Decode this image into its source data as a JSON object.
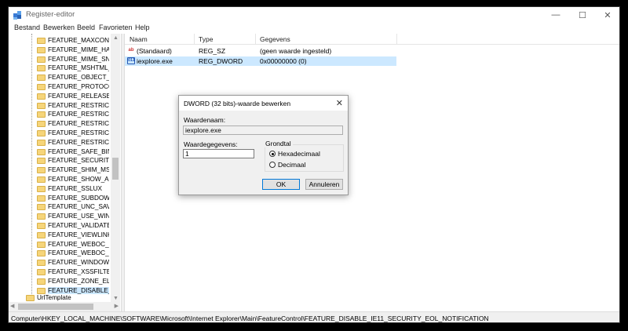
{
  "window": {
    "title": "Register-editor",
    "controls": {
      "minimize": "—",
      "maximize": "☐",
      "close": "✕"
    }
  },
  "menu": [
    "Bestand",
    "Bewerken",
    "Beeld",
    "Favorieten",
    "Help"
  ],
  "tree": {
    "items": [
      "FEATURE_MAXCONNEC",
      "FEATURE_MIME_HANDI",
      "FEATURE_MIME_SNIFFII",
      "FEATURE_MSHTML_AU",
      "FEATURE_OBJECT_CACI",
      "FEATURE_PROTOCOL_L",
      "FEATURE_RELEASE_CAL",
      "FEATURE_RESTRICT_AB",
      "FEATURE_RESTRICT_AC",
      "FEATURE_RESTRICT_FIL",
      "FEATURE_RESTRICT_OB",
      "FEATURE_RESTRICT_RES",
      "FEATURE_SAFE_BINDTO",
      "FEATURE_SECURITYBAN",
      "FEATURE_SHIM_MSHEL",
      "FEATURE_SHOW_APP_P",
      "FEATURE_SSLUX",
      "FEATURE_SUBDOWNLO",
      "FEATURE_UNC_SAVEDFI",
      "FEATURE_USE_WINDOW",
      "FEATURE_VALIDATE_NA",
      "FEATURE_VIEWLINKEDV",
      "FEATURE_WEBOC_MOV",
      "FEATURE_WEBOC_POPI",
      "FEATURE_WINDOW_RES",
      "FEATURE_XSSFILTER",
      "FEATURE_ZONE_ELEVAT",
      "FEATURE_DISABLE_IE11"
    ],
    "selected_index": 27,
    "sibling": "UrlTemplate"
  },
  "list": {
    "columns": [
      "Naam",
      "Type",
      "Gegevens"
    ],
    "rows": [
      {
        "icon": "ab",
        "name": "(Standaard)",
        "type": "REG_SZ",
        "data": "(geen waarde ingesteld)"
      },
      {
        "icon": "bin",
        "name": "iexplore.exe",
        "type": "REG_DWORD",
        "data": "0x00000000 (0)"
      }
    ],
    "selected_index": 1
  },
  "status": "Computer\\HKEY_LOCAL_MACHINE\\SOFTWARE\\Microsoft\\Internet Explorer\\Main\\FeatureControl\\FEATURE_DISABLE_IE11_SECURITY_EOL_NOTIFICATION",
  "dialog": {
    "title": "DWORD (32 bits)-waarde bewerken",
    "close": "✕",
    "value_name_label": "Waardenaam:",
    "value_name": "iexplore.exe",
    "value_data_label": "Waardegegevens:",
    "value_data": "1",
    "base_label": "Grondtal",
    "radio_hex": "Hexadecimaal",
    "radio_dec": "Decimaal",
    "selected_base": "hex",
    "ok": "OK",
    "cancel": "Annuleren"
  }
}
